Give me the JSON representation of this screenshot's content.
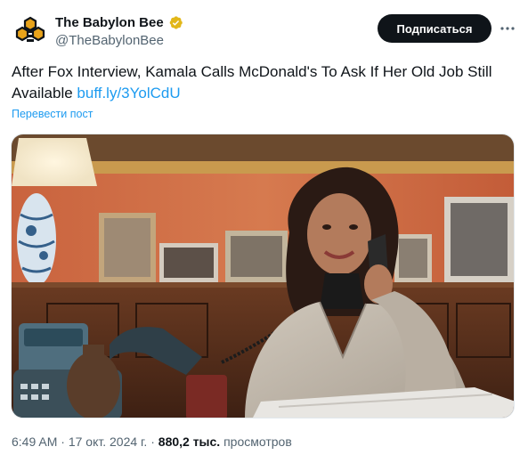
{
  "author": {
    "display_name": "The Babylon Bee",
    "handle": "@TheBabylonBee",
    "verified": true,
    "avatar_icon": "bee-logo-icon",
    "verified_icon": "verified-badge-icon",
    "verified_color": "#e2b719"
  },
  "header": {
    "subscribe_label": "Подписаться",
    "more_icon": "ellipsis-icon"
  },
  "tweet": {
    "text": "After Fox Interview, Kamala Calls McDonald's To Ask If Her Old Job Still Available ",
    "link": "buff.ly/3YolCdU",
    "translate_label": "Перевести пост"
  },
  "media": {
    "type": "photo"
  },
  "meta": {
    "time": "6:49 AM",
    "separator": " · ",
    "date": "17 окт. 2024 г.",
    "views_count": "880,2 тыс.",
    "views_label": " просмотров"
  },
  "colors": {
    "link": "#1d9bf0",
    "text": "#0f1419",
    "secondary": "#536471",
    "button_bg": "#0f1419"
  }
}
